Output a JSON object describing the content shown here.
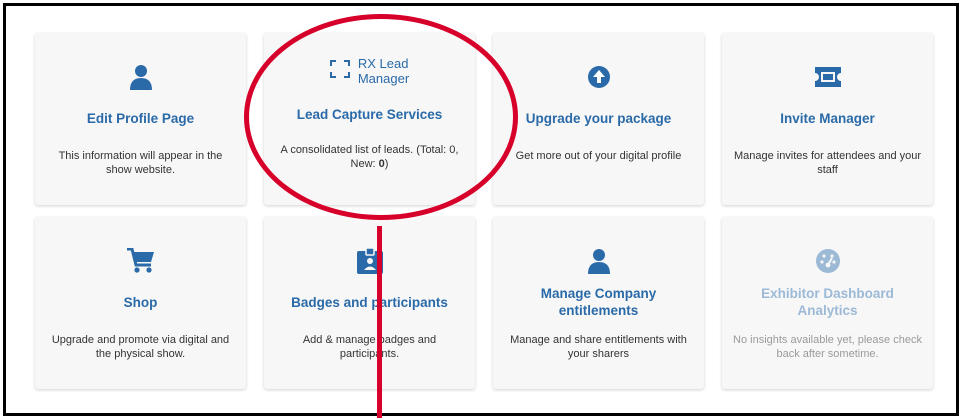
{
  "cards": [
    {
      "icon": "person-icon",
      "title": "Edit Profile Page",
      "desc": "This information will appear in the show website."
    },
    {
      "icon": "bracket-scan-icon",
      "rx_label_line1": "RX Lead",
      "rx_label_line2": "Manager",
      "title": "Lead Capture Services",
      "desc_prefix": "A consolidated list of leads. (Total: 0, New: ",
      "desc_new": "0",
      "desc_suffix": ")"
    },
    {
      "icon": "arrow-up-circle-icon",
      "title": "Upgrade your package",
      "desc": "Get more out of your digital profile"
    },
    {
      "icon": "ticket-icon",
      "title": "Invite Manager",
      "desc": "Manage invites for attendees and your staff"
    },
    {
      "icon": "cart-icon",
      "title": "Shop",
      "desc": "Upgrade and promote via digital and the physical show."
    },
    {
      "icon": "badge-icon",
      "title": "Badges and participants",
      "desc": "Add & manage badges and participants."
    },
    {
      "icon": "person-icon",
      "title": "Manage Company entitlements",
      "desc": "Manage and share entitlements with your sharers"
    },
    {
      "icon": "gauge-icon",
      "title": "Exhibitor Dashboard Analytics",
      "desc": "No insights available yet, please check back after sometime.",
      "disabled": true
    }
  ],
  "colors": {
    "accent": "#2a6aa8",
    "annotation": "#d6002a",
    "disabled_title": "#9cb9d6"
  }
}
